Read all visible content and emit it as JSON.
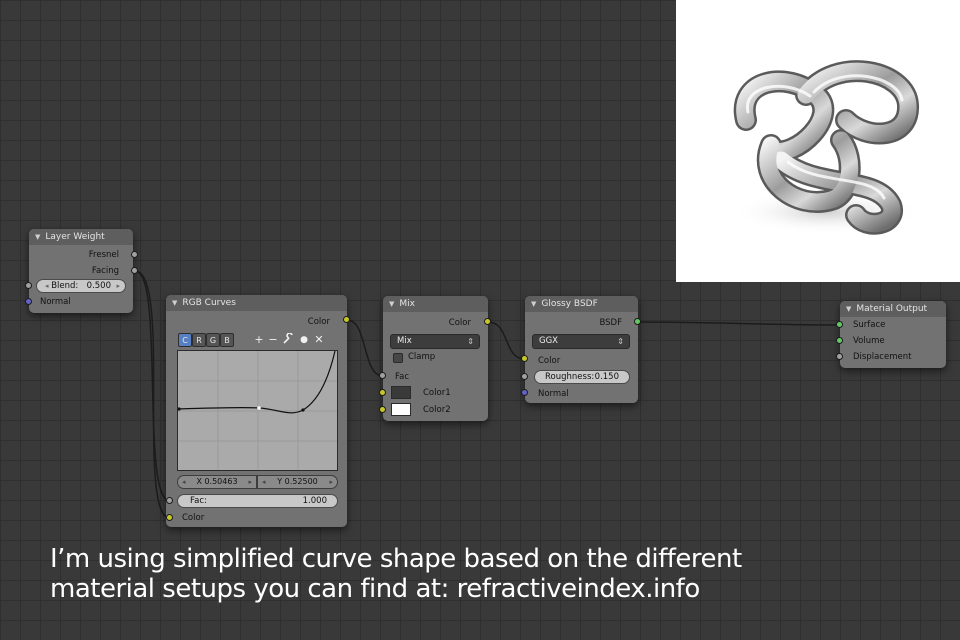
{
  "nodes": {
    "layer_weight": {
      "title": "Layer Weight",
      "outputs": [
        "Fresnel",
        "Facing"
      ],
      "blend_label": "Blend:",
      "blend_value": "0.500",
      "normal_label": "Normal"
    },
    "rgb_curves": {
      "title": "RGB Curves",
      "output": "Color",
      "channels": [
        "C",
        "R",
        "G",
        "B"
      ],
      "tools": [
        "+",
        "−",
        "🔧",
        "●",
        "✕"
      ],
      "x_readout": "X 0.50463",
      "y_readout": "Y 0.52500",
      "fac_label": "Fac:",
      "fac_value": "1.000",
      "color_label": "Color"
    },
    "mix": {
      "title": "Mix",
      "output": "Color",
      "blend_mode": "Mix",
      "clamp_label": "Clamp",
      "fac_label": "Fac",
      "color1_label": "Color1",
      "color2_label": "Color2",
      "color1": "#3a3a3a",
      "color2": "#ffffff"
    },
    "glossy": {
      "title": "Glossy BSDF",
      "output": "BSDF",
      "distribution": "GGX",
      "color_label": "Color",
      "roughness_label": "Roughness:",
      "roughness_value": "0.150",
      "normal_label": "Normal"
    },
    "material_output": {
      "title": "Material Output",
      "inputs": [
        "Surface",
        "Volume",
        "Displacement"
      ]
    }
  },
  "socket_colors": {
    "float": "#a1a1a1",
    "color": "#c7c729",
    "vector": "#6363c7",
    "shader": "#63c763"
  },
  "caption": {
    "line1": "I’m using simplified curve shape based on the different",
    "line2": "material setups you can find at: refractiveindex.info"
  },
  "preview": {
    "subject": "chrome-knot-render"
  }
}
